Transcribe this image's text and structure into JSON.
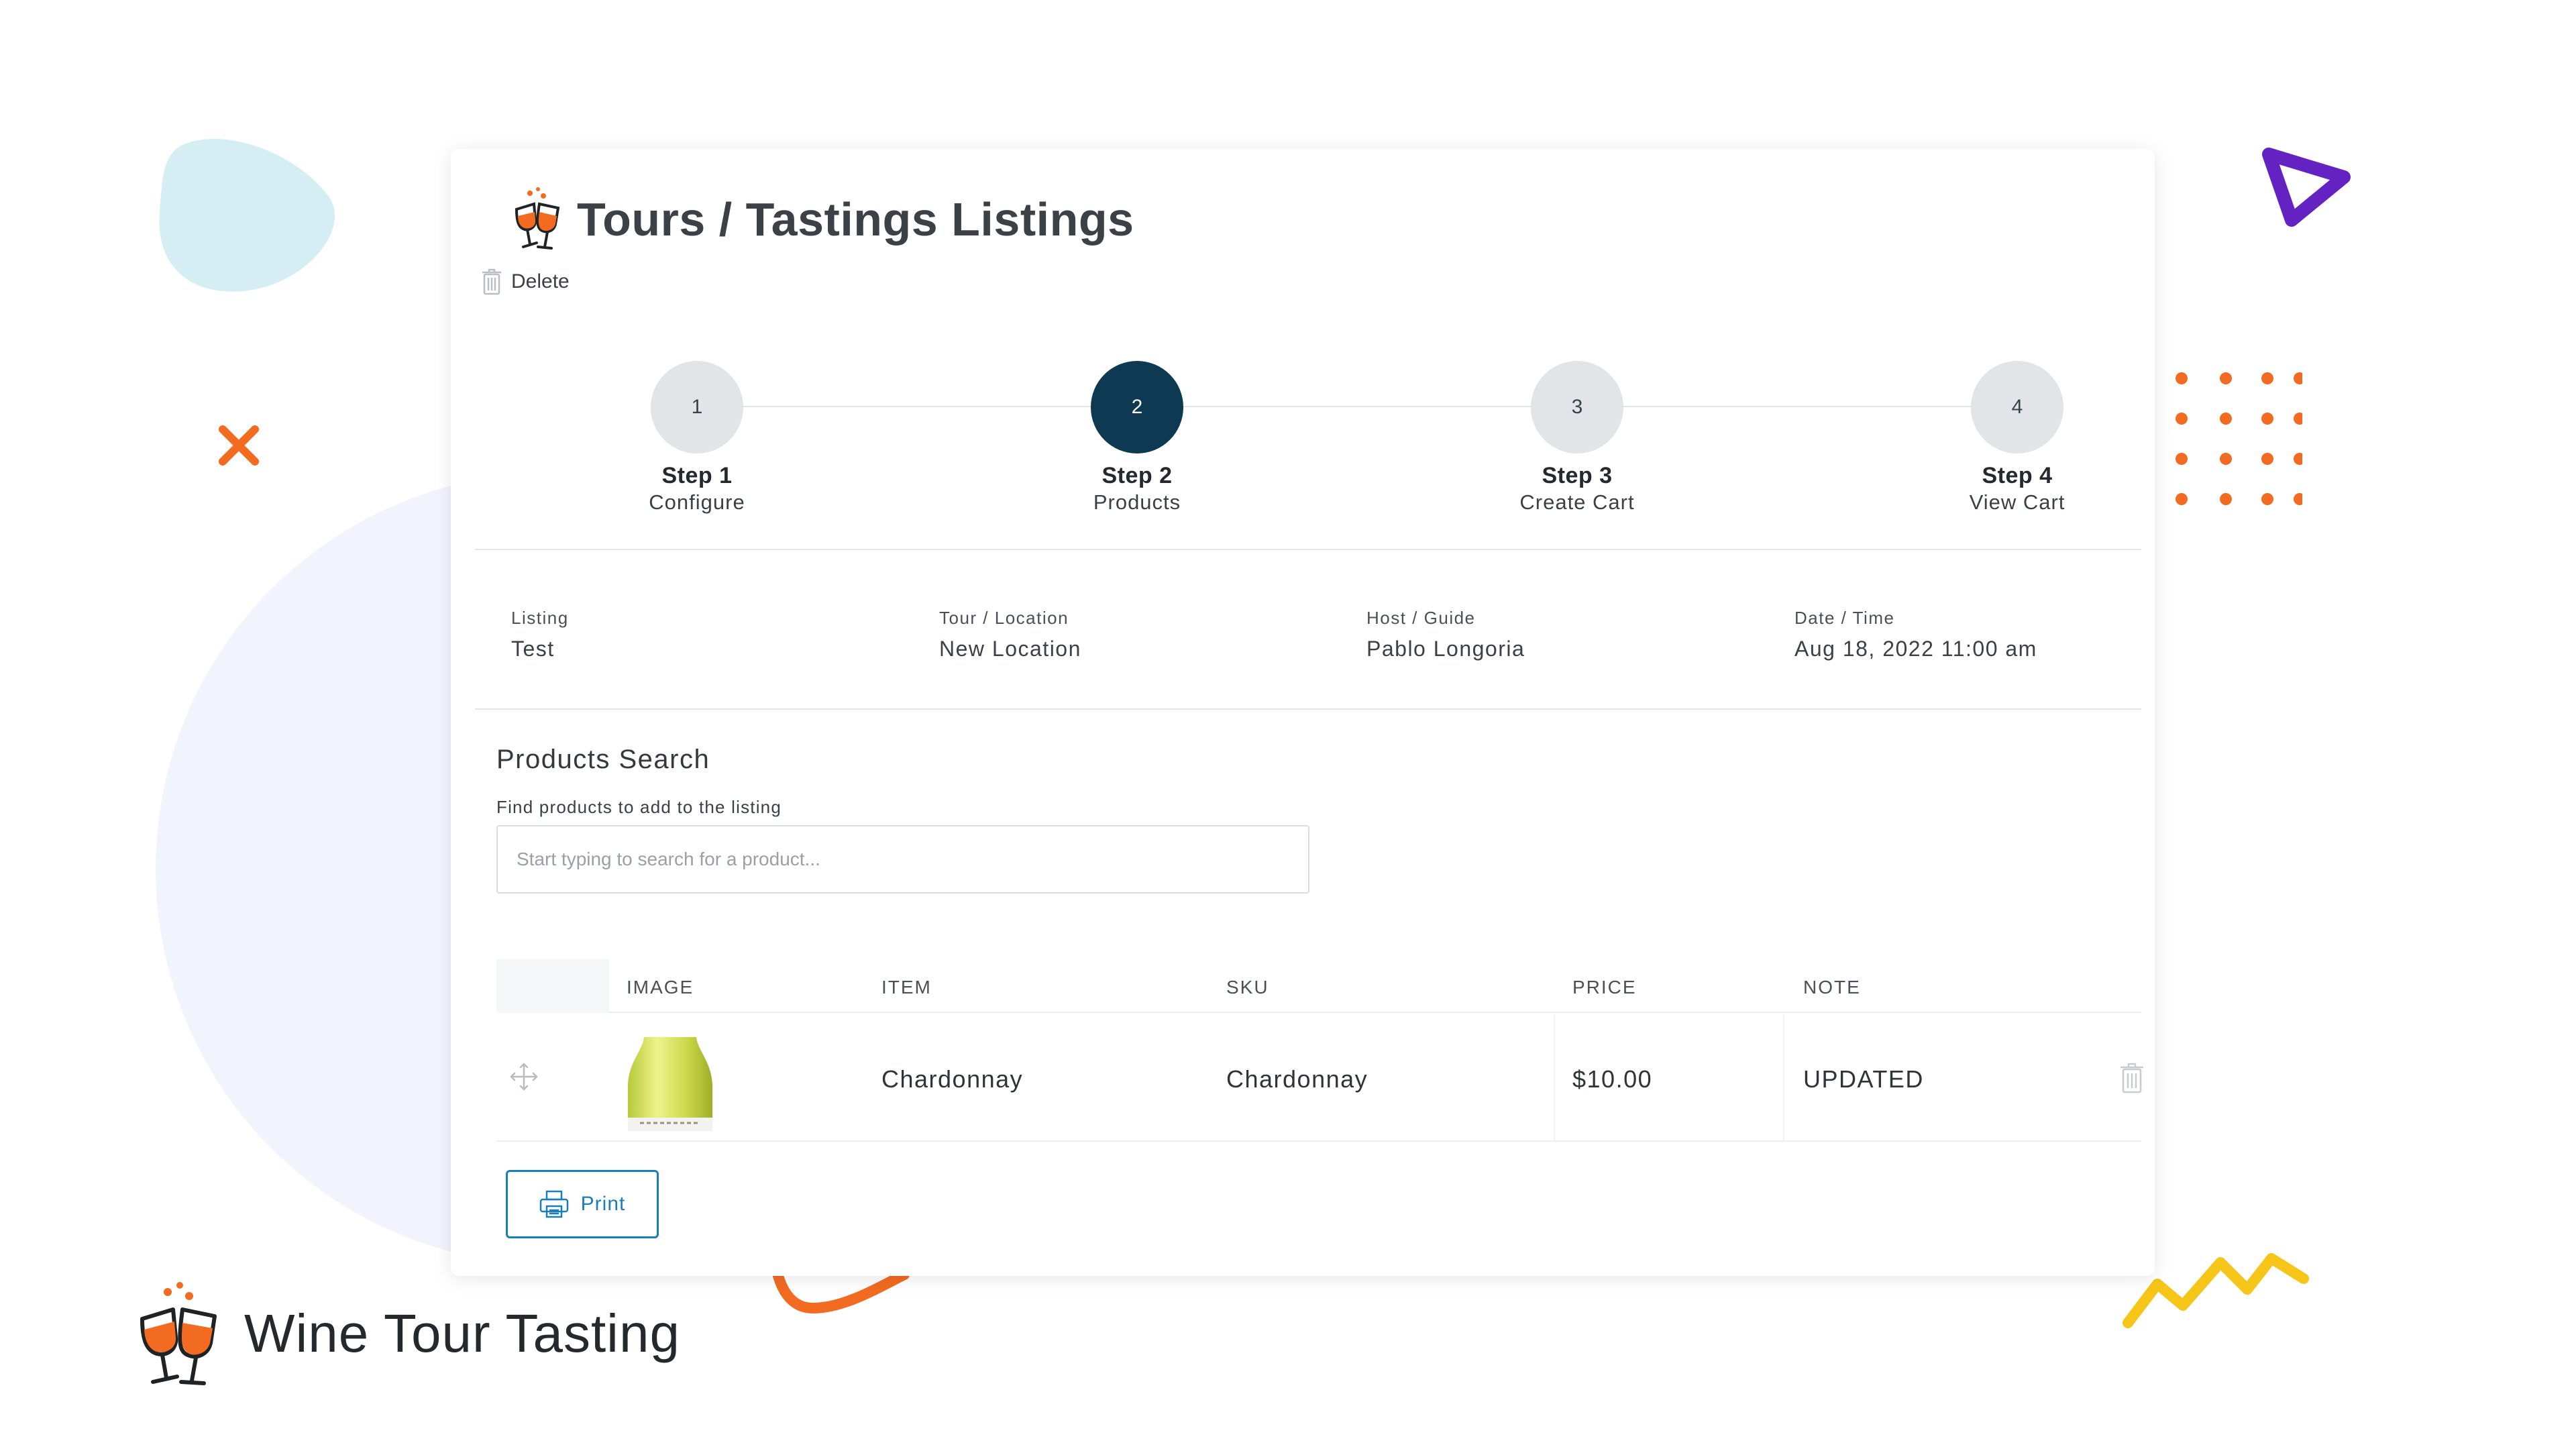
{
  "page": {
    "title": "Tours / Tastings Listings",
    "delete_label": "Delete"
  },
  "stepper": {
    "active_step": 2,
    "steps": [
      {
        "number": "1",
        "title": "Step 1",
        "subtitle": "Configure"
      },
      {
        "number": "2",
        "title": "Step 2",
        "subtitle": "Products"
      },
      {
        "number": "3",
        "title": "Step 3",
        "subtitle": "Create Cart"
      },
      {
        "number": "4",
        "title": "Step 4",
        "subtitle": "View Cart"
      }
    ]
  },
  "listing_info": [
    {
      "label": "Listing",
      "value": "Test"
    },
    {
      "label": "Tour / Location",
      "value": "New Location"
    },
    {
      "label": "Host / Guide",
      "value": "Pablo Longoria"
    },
    {
      "label": "Date / Time",
      "value": "Aug 18, 2022 11:00 am"
    }
  ],
  "products_search": {
    "title": "Products Search",
    "help_text": "Find products to add to the listing",
    "placeholder": "Start typing to search for a product..."
  },
  "table": {
    "columns": [
      "IMAGE",
      "ITEM",
      "SKU",
      "PRICE",
      "NOTE"
    ],
    "rows": [
      {
        "image": "wine-bottle-thumbnail",
        "item": "Chardonnay",
        "sku": "Chardonnay",
        "price": "$10.00",
        "note": "UPDATED"
      }
    ]
  },
  "actions": {
    "print_label": "Print"
  },
  "brand": {
    "name": "Wine Tour Tasting"
  },
  "colors": {
    "active_step": "#0d3a52",
    "inactive_step": "#e2e4e7",
    "print_accent": "#1a7fb8",
    "decor_orange": "#f26b21",
    "decor_purple": "#6422c2",
    "decor_yellow": "#f5c518",
    "decor_blue_blob": "#d5eef4",
    "decor_circle": "#f1f4fc"
  },
  "icons": {
    "title": "wine-glasses-icon",
    "delete": "trash-icon",
    "row_move": "move-icon",
    "row_delete": "trash-icon",
    "print": "printer-icon",
    "brand": "wine-glasses-icon"
  }
}
